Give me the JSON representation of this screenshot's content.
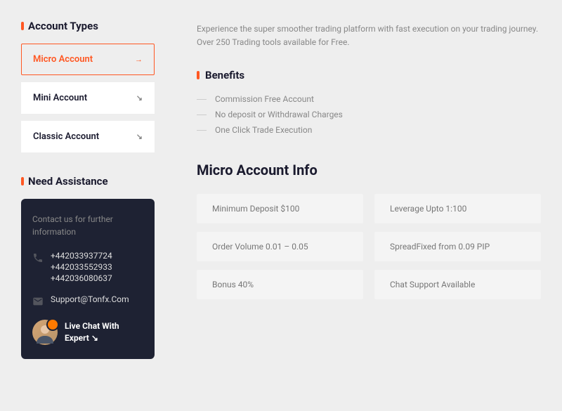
{
  "sidebar": {
    "title": "Account Types",
    "tabs": [
      {
        "label": "Micro Account",
        "active": true
      },
      {
        "label": "Mini Account",
        "active": false
      },
      {
        "label": "Classic Account",
        "active": false
      }
    ],
    "assist_title": "Need Assistance",
    "assist_text": "Contact us for further information",
    "phones": [
      "+442033937724",
      "+442033552933",
      "+442036080637"
    ],
    "email": "Support@Tonfx.Com",
    "chat_label": "Live Chat With Expert  ↘"
  },
  "main": {
    "intro": "Experience the super smoother trading platform with fast execution on your trading journey. Over 250 Trading tools available for Free.",
    "benefits_title": "Benefits",
    "benefits": [
      "Commission Free Account",
      "No deposit or Withdrawal Charges",
      "One Click  Trade Execution"
    ],
    "info_title": "Micro Account Info",
    "info_cards": [
      "Minimum Deposit $100",
      "Leverage Upto 1:100",
      "Order Volume 0.01 – 0.05",
      "SpreadFixed from 0.09 PIP",
      "Bonus 40%",
      "Chat Support  Available"
    ]
  }
}
